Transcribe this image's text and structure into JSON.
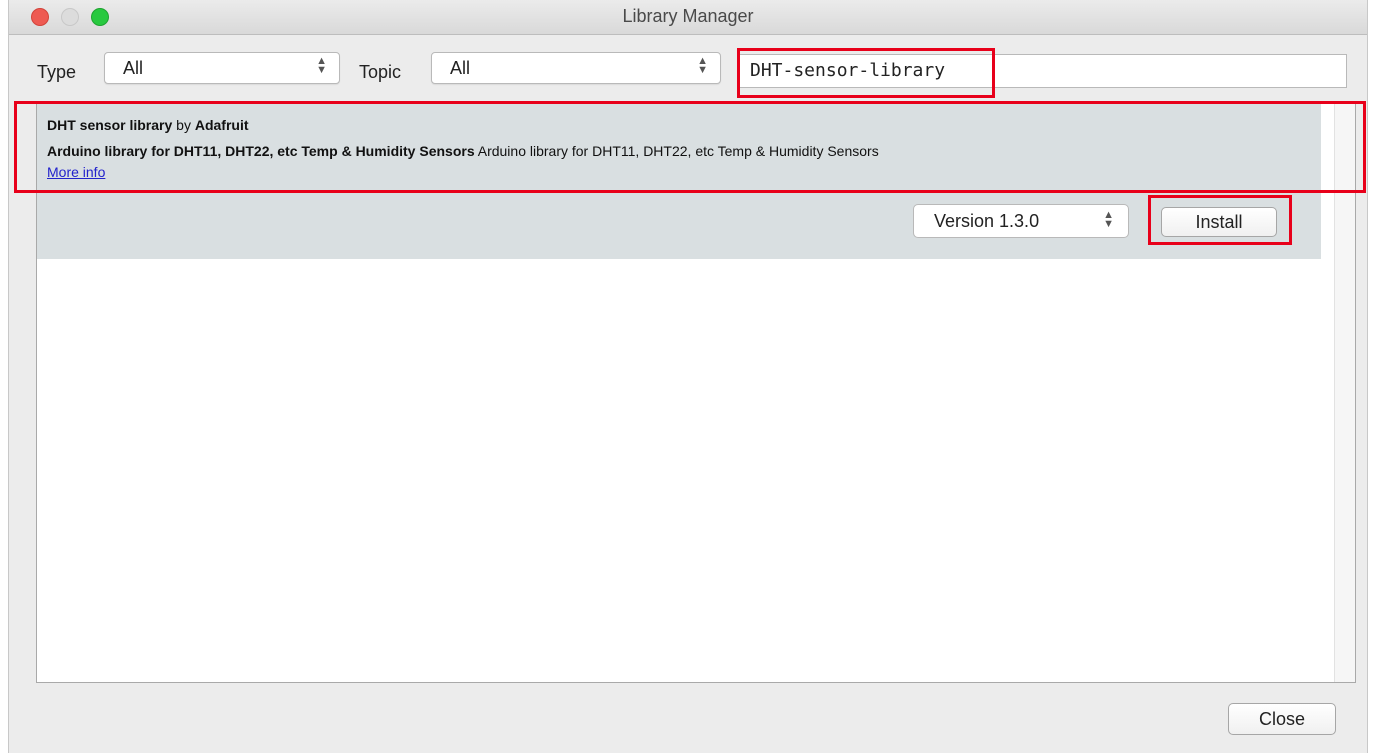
{
  "window": {
    "title": "Library Manager"
  },
  "filters": {
    "type_label": "Type",
    "type_value": "All",
    "topic_label": "Topic",
    "topic_value": "All",
    "search_value": "DHT-sensor-library"
  },
  "results": [
    {
      "name": "DHT sensor library",
      "by": "by",
      "author": "Adafruit",
      "summary": "Arduino library for DHT11, DHT22, etc Temp & Humidity Sensors",
      "description": "Arduino library for DHT11, DHT22, etc Temp & Humidity Sensors",
      "more_info": "More info",
      "version": "Version 1.3.0",
      "install_label": "Install"
    }
  ],
  "footer": {
    "close_label": "Close"
  },
  "colors": {
    "highlight": "#e8001a",
    "entry_bg": "#d9dfe1",
    "link": "#2222cc"
  }
}
